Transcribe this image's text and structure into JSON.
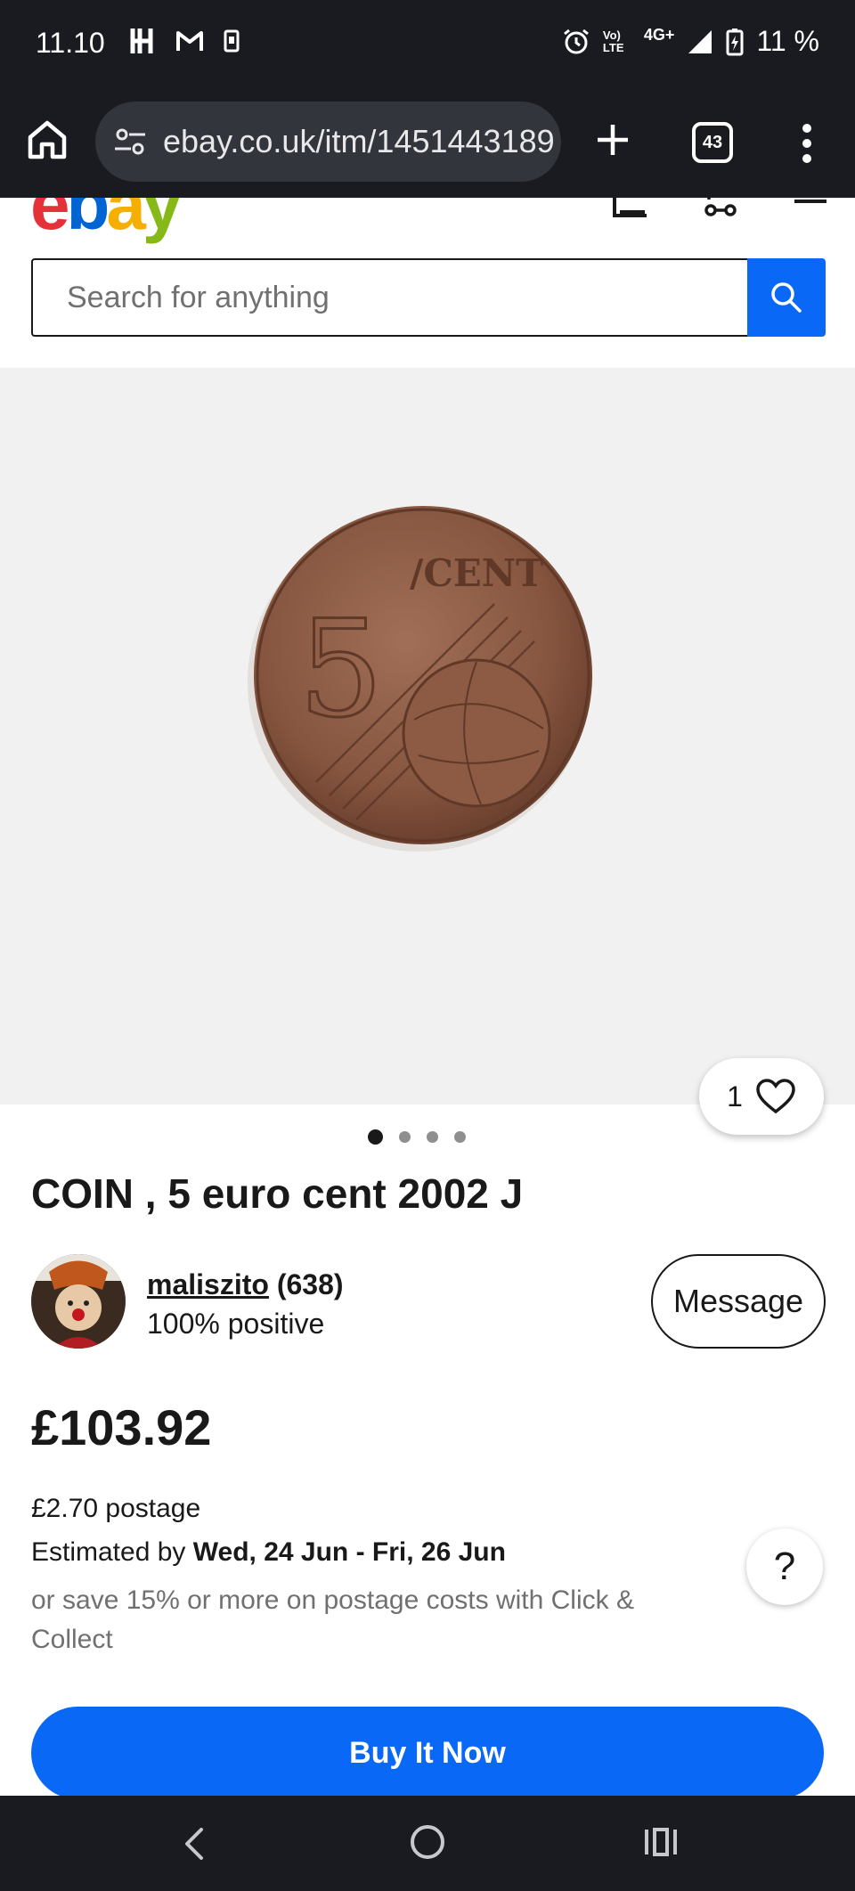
{
  "status_bar": {
    "time": "11.10",
    "battery": "11 %",
    "network": "4G+",
    "volte": "Vo) LTE"
  },
  "browser": {
    "url": "ebay.co.uk/itm/1451443189",
    "tab_count": "43"
  },
  "header": {
    "logo_letters": [
      "e",
      "b",
      "a",
      "y"
    ],
    "logo_colors": [
      "#e53238",
      "#0064d2",
      "#f5af02",
      "#86b817"
    ]
  },
  "search": {
    "placeholder": "Search for anything"
  },
  "gallery": {
    "watch_count": "1",
    "image_count": 4,
    "active_index": 0
  },
  "item": {
    "title": "COIN , 5 euro cent 2002 J"
  },
  "seller": {
    "name": "maliszito",
    "feedback_count": "(638)",
    "positive": "100% positive",
    "message_label": "Message"
  },
  "price": {
    "amount": "£103.92"
  },
  "shipping": {
    "postage": "£2.70 postage",
    "estimated_prefix": "Estimated by ",
    "estimated_dates": "Wed, 24 Jun - Fri, 26 Jun",
    "collect_note": "or save 15% or more on postage costs with Click & Collect",
    "help_label": "?"
  },
  "actions": {
    "buy_label": "Buy It Now"
  },
  "colors": {
    "accent": "#0968f6",
    "system_bar": "#1a1b20"
  }
}
